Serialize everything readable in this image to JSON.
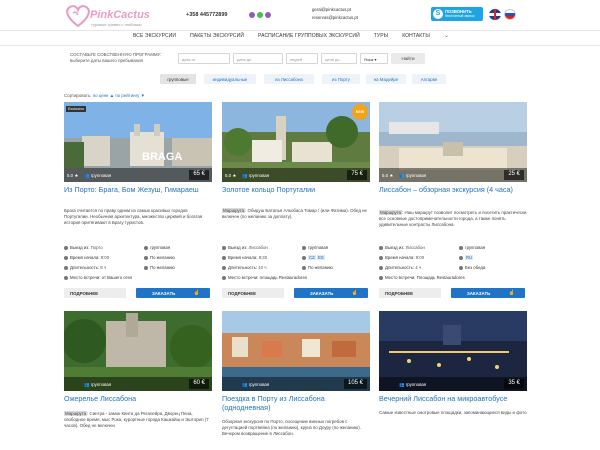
{
  "brand": {
    "logo": "PinkCactus",
    "tagline": "туровые тревел с любовью",
    "pink": "#e99bc6"
  },
  "contact": {
    "phone": "+358 445772899",
    "emails": [
      "geral@pinkcactus.pt",
      "reservas@pinkcactus.pt"
    ],
    "skype_label": "ПОЗВОНИТЬ",
    "skype_sub": "бесплатный звонок"
  },
  "nav": [
    "ВСЕ ЭКСКУРСИИ",
    "ПАКЕТЫ ЭКСКУРСИЙ",
    "РАСПИСАНИЕ ГРУППОВЫХ ЭКСКУРСИЙ",
    "ТУРЫ",
    "КОНТАКТЫ"
  ],
  "search": {
    "label": "СОСТАВЬТЕ СОБСТВЕННУЮ ПРОГРАММУ: выберите даты вашего пребывания",
    "date_from": "дата от",
    "date_to": "дата до",
    "people": "людей",
    "price_to": "цена до",
    "lang": "Язык",
    "button": "Найти"
  },
  "filters": [
    "групповые",
    "индивидуальные",
    "из Лиссабона",
    "из Порту",
    "на Мадейре",
    "Алгарве"
  ],
  "sort": {
    "label": "Сортировать:",
    "by_price": "по цене ▲",
    "by_rating": "по рейтингу ▼"
  },
  "cards": [
    {
      "title": "Из Порто: Брага, Бом Жезуш, Гимараеш",
      "desc": "Брага считается по праву одним из самых красивых городов Португалии. Необычная архитектура, множество церквей и богатая история притягивают в Брагу туристов.",
      "badge": "Exclusivo",
      "rating": "5.0",
      "group_label": "групповая",
      "price": "65 €",
      "departure": "Порто",
      "start_time": "9:00",
      "duration": "8 ч",
      "meeting": "Место встречи: от Вашего отел",
      "tags": [
        "групповая",
        "По желанию",
        "По желанию"
      ]
    },
    {
      "title": "Золотое кольцо Португалии",
      "desc_highlight": "Маршрута",
      "desc": ": Обидуш Баталья Алкобаса Томар / (или Фатима). Обед не включен (по желанию за доплату).",
      "badge": "NEW",
      "rating": "5.0",
      "group_label": "групповая",
      "price": "75 €",
      "departure": "Лиссабон",
      "start_time": "8:30",
      "duration": "10 ч",
      "meeting": "Место встречи: площадь Restauradores",
      "tags": [
        "групповая",
        "CZ",
        "ES",
        "По желанию"
      ]
    },
    {
      "title": "Лиссабон – обзорная экскурсия (4 часа)",
      "desc_highlight": "Маршрута",
      "desc": ": Наш маршрут позволит посмотреть и посетить практически все основные достопримечательности города, а также понять удивительные контрасты Лиссабона.",
      "rating": "5.0",
      "group_label": "групповая",
      "price": "25 €",
      "departure": "Лиссабон",
      "start_time": "9:00",
      "duration": "4 ч",
      "meeting": "Место встречи: Площадь Restauradores",
      "tags": [
        "групповая",
        "RU",
        "Без обеда"
      ]
    },
    {
      "title": "Ожерелье Лиссабона",
      "desc_highlight": "Маршрута",
      "desc": ": Синтра - замок Кинта да Регалейра, Дворец Пена, свободное время, мыс Рока, курортные города Кашкайш и Эшторил (7 часов). Обед не включен",
      "group_label": "групповая",
      "price": "60 €"
    },
    {
      "title": "Поездка в Порту из Лиссабона (однодневная)",
      "desc": "Обзорная экскурсия по Порто, посещение винных погребов с дегустацией портвейна (по желанию), круиз по Доуру (по желанию). Вечером возвращение в Лиссабон.",
      "group_label": "групповая",
      "price": "105 €"
    },
    {
      "title": "Вечерний Лиссабон на микроавтобусе",
      "desc": "Самые известные смотровые площадки, запоминающиеся виды и фото",
      "group_label": "групповая",
      "price": "35 €"
    }
  ],
  "labels": {
    "departure": "Выезд из:",
    "start": "Время начала:",
    "duration": "Длительность:",
    "more": "ПОДРОБНЕЕ",
    "order": "ЗАКАЗАТЬ"
  },
  "colors": {
    "accent": "#2174c5",
    "order_button": "#2174c5",
    "new_badge": "#f2a31a"
  }
}
